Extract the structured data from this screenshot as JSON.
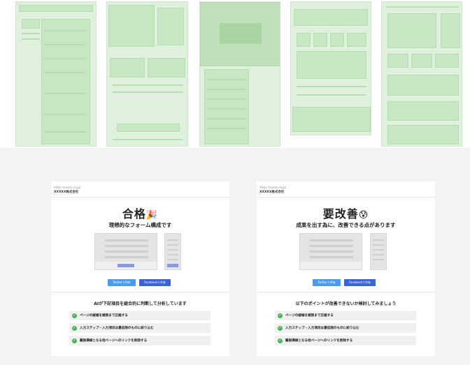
{
  "results": [
    {
      "url": "https://xxxxx.co.jp/",
      "company": "XXXXX株式会社",
      "verdict": "合格",
      "emoji": "🎉",
      "subtitle": "理想的なフォーム構成です",
      "twitter_label": "Twitterで共有",
      "facebook_label": "Facebookで共有",
      "analysis_title": "AIが下記項目を総合的に判断して分析しています",
      "items": [
        "ページの縦幅を極限まで圧縮する",
        "入力ステップ・入力項目は最低限のものに絞り込む",
        "離脱導線となる他ページへのリンクを削除する"
      ]
    },
    {
      "url": "https://xxxxx.co.jp/",
      "company": "XXXXX株式会社",
      "verdict": "要改善",
      "emoji": "😰",
      "subtitle": "成果を出す為に、改善できる点があります",
      "twitter_label": "Twitterで共有",
      "facebook_label": "Facebookで共有",
      "analysis_title": "以下のポイントが改善できないか検討してみましょう",
      "items": [
        "ページの縦幅を極限まで圧縮する",
        "入力ステップ・入力項目は最低限のものに絞り込む",
        "離脱導線となる他ページへのリンクを削除する"
      ]
    }
  ],
  "colors": {
    "thumb_bg": "#dff0dd",
    "thumb_block": "#c7e6c3",
    "check": "#49b35b",
    "twitter": "#4c9bea",
    "facebook": "#3b63d6",
    "cta": "#8897e6"
  },
  "icons": [
    "check-icon",
    "party-popper-emoji",
    "anxious-face-emoji"
  ]
}
